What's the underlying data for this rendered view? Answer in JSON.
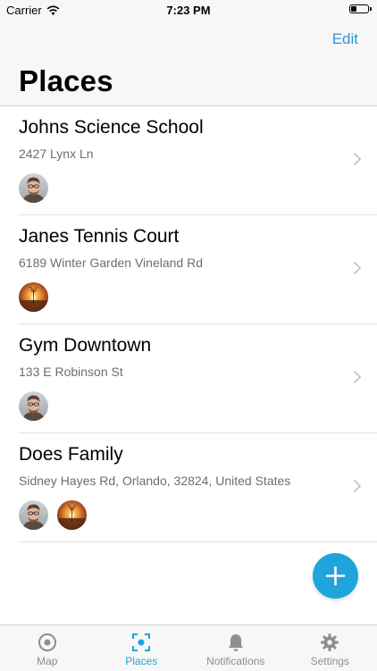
{
  "status_bar": {
    "carrier": "Carrier",
    "time": "7:23 PM"
  },
  "nav": {
    "edit_label": "Edit",
    "title": "Places"
  },
  "places": [
    {
      "name": "Johns Science School",
      "address": "2427 Lynx Ln",
      "avatars": [
        "man-photo"
      ]
    },
    {
      "name": "Janes Tennis Court",
      "address": "6189 Winter Garden Vineland Rd",
      "avatars": [
        "sunset-photo"
      ]
    },
    {
      "name": "Gym Downtown",
      "address": "133 E Robinson St",
      "avatars": [
        "man-photo"
      ]
    },
    {
      "name": "Does Family",
      "address": "Sidney Hayes Rd, Orlando, 32824, United States",
      "avatars": [
        "man-photo",
        "sunset-photo"
      ]
    }
  ],
  "tabs": [
    {
      "label": "Map",
      "icon": "map-target-icon",
      "active": false
    },
    {
      "label": "Places",
      "icon": "places-focus-icon",
      "active": true
    },
    {
      "label": "Notifications",
      "icon": "bell-icon",
      "active": false
    },
    {
      "label": "Settings",
      "icon": "gear-icon",
      "active": false
    }
  ],
  "colors": {
    "accent": "#1fa4dc",
    "link": "#2a97d6"
  }
}
